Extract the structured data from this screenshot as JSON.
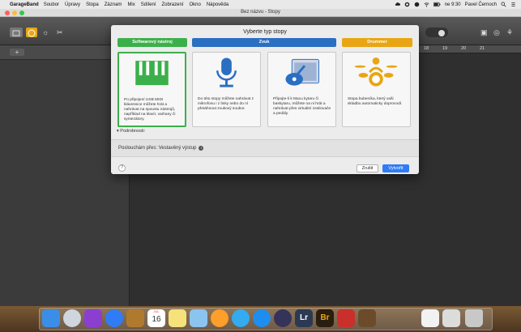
{
  "menubar": {
    "app_name": "GarageBand",
    "items": [
      "Soubor",
      "Úpravy",
      "Stopa",
      "Záznam",
      "Mix",
      "Sdílení",
      "Zobrazení",
      "Okno",
      "Nápověda"
    ],
    "clock": "ne 9:30",
    "user": "Pavel Černoch"
  },
  "window": {
    "title": "Bez názvu - Stopy"
  },
  "ruler": {
    "marks": [
      "18",
      "19",
      "20",
      "21"
    ]
  },
  "dialog": {
    "title": "Vyberte typ stopy",
    "categories": [
      {
        "label": "Softwarový nástroj",
        "color": "#3bb04a"
      },
      {
        "label": "Zvuk",
        "color": "#2a6fc2"
      },
      {
        "label": "Drummer",
        "color": "#e8a614"
      }
    ],
    "cards": [
      {
        "text": "Po připojení USB MIDI klávesnice můžete hrát a nahrávat na spoustu nástrojů, například na klavír, varhany či syntezátory.",
        "icon": "piano-keys-icon",
        "selected": true
      },
      {
        "text": "Do této stopy můžete nahrávat z mikrofonu i z linky nebo do ní přetáhnout zvukový soubor.",
        "icon": "microphone-icon",
        "selected": false
      },
      {
        "text": "Připojte-li k Macu kytaru či baskytaru, můžete na ni hrát a nahrávat přes virtuální zesilovače a pedály.",
        "icon": "guitar-amp-icon",
        "selected": false
      },
      {
        "text": "Stopa bubeníka, který vaši skladbu automaticky doprovodí.",
        "icon": "drummer-icon",
        "selected": false
      }
    ],
    "details_label": "▾ Podrobnosti:",
    "listening_label": "Poslouchám přes: Vestavěný výstup",
    "help_label": "?",
    "cancel_label": "Zrušit",
    "create_label": "Vytvořit"
  },
  "dock": {
    "calendar_day": "16",
    "calendar_month": "JUL",
    "lightroom_label": "Lr",
    "bridge_label": "Br"
  }
}
